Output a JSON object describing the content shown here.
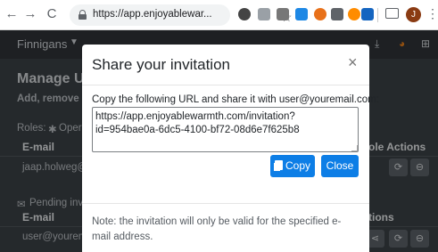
{
  "browser": {
    "url": "https://app.enjoyablewar...",
    "profile_initial": "J"
  },
  "app": {
    "brand": "Finnigans",
    "heading": "Manage Use",
    "subheading": "Add, remove or",
    "roles_label": "Roles:",
    "roles_value": "Opera",
    "table1_email_header": "E-mail",
    "table1_role_actions_header": "ole Actions",
    "table1_row_email": "jaap.holweg@e",
    "pending_label": "Pending invi",
    "table2_email_header": "E-mail",
    "table2_actions_header": "tions",
    "table2_row_email": "user@youremai"
  },
  "modal": {
    "title": "Share your invitation",
    "close_symbol": "×",
    "label": "Copy the following URL and share it with user@youremail.com:",
    "url_value": "https://app.enjoyablewarmth.com/invitation?id=954bae0a-6dc5-4100-bf72-08d6e7f625b8",
    "copy_label": "Copy",
    "close_label": "Close",
    "note": "Note: the invitation will only be valid for the specified e-mail address."
  }
}
